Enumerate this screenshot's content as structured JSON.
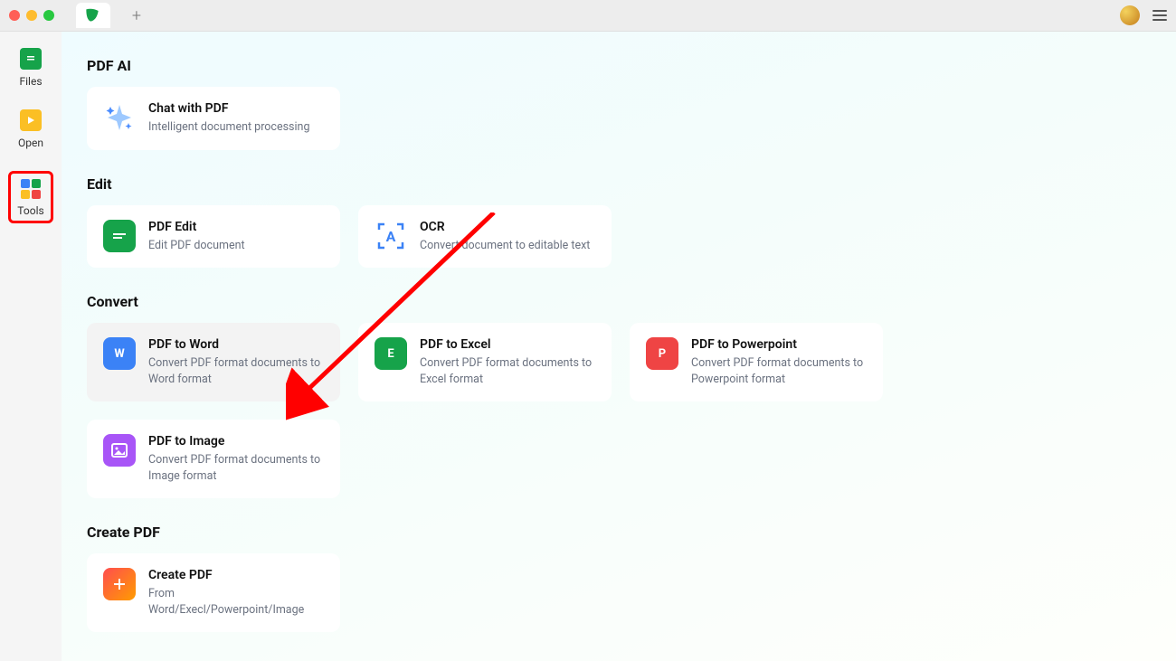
{
  "sidebar": {
    "items": [
      {
        "label": "Files"
      },
      {
        "label": "Open"
      },
      {
        "label": "Tools"
      }
    ]
  },
  "sections": {
    "pdfai": {
      "heading": "PDF AI",
      "chat": {
        "title": "Chat with PDF",
        "desc": "Intelligent document processing"
      }
    },
    "edit": {
      "heading": "Edit",
      "pdfedit": {
        "title": "PDF Edit",
        "desc": "Edit PDF document"
      },
      "ocr": {
        "title": "OCR",
        "desc": "Convert document to editable text"
      }
    },
    "convert": {
      "heading": "Convert",
      "word": {
        "title": "PDF to Word",
        "desc": "Convert PDF format documents to Word format"
      },
      "excel": {
        "title": "PDF to Excel",
        "desc": "Convert PDF format documents to Excel format"
      },
      "ppt": {
        "title": "PDF to Powerpoint",
        "desc": "Convert PDF format documents to Powerpoint format"
      },
      "image": {
        "title": "PDF to Image",
        "desc": "Convert PDF format documents to Image format"
      }
    },
    "create": {
      "heading": "Create PDF",
      "createpdf": {
        "title": "Create PDF",
        "desc": "From Word/Execl/Powerpoint/Image"
      }
    }
  }
}
